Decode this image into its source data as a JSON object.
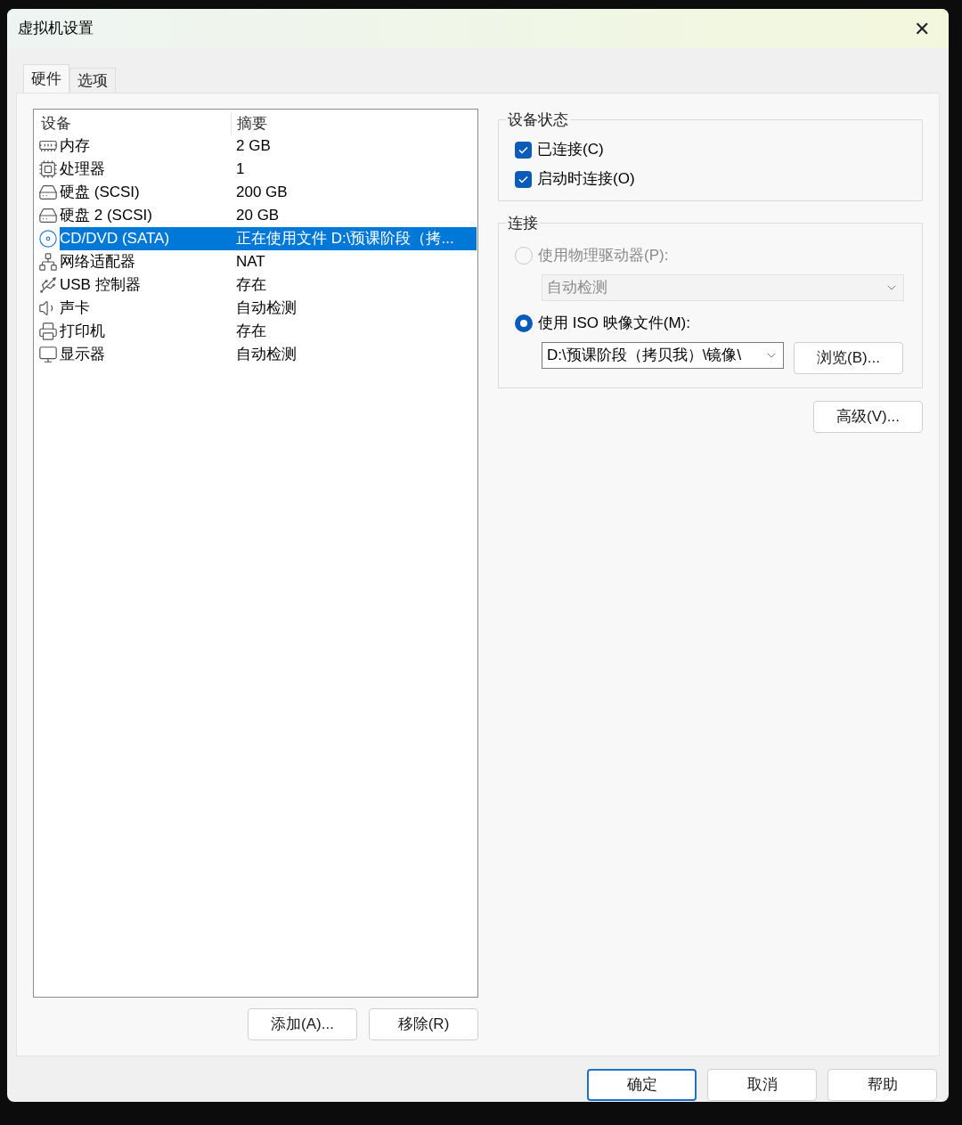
{
  "window": {
    "title": "虚拟机设置",
    "close": "✕"
  },
  "tabs": [
    {
      "label": "硬件",
      "selected": true
    },
    {
      "label": "选项",
      "selected": false
    }
  ],
  "device_list": {
    "columns": [
      "设备",
      "摘要"
    ],
    "rows": [
      {
        "device": "内存",
        "summary": "2 GB",
        "selected": false
      },
      {
        "device": "处理器",
        "summary": "1",
        "selected": false
      },
      {
        "device": "硬盘 (SCSI)",
        "summary": "200 GB",
        "selected": false
      },
      {
        "device": "硬盘 2 (SCSI)",
        "summary": "20 GB",
        "selected": false
      },
      {
        "device": "CD/DVD (SATA)",
        "summary": "正在使用文件 D:\\预课阶段（拷...",
        "selected": true
      },
      {
        "device": "网络适配器",
        "summary": "NAT",
        "selected": false
      },
      {
        "device": "USB 控制器",
        "summary": "存在",
        "selected": false
      },
      {
        "device": "声卡",
        "summary": "自动检测",
        "selected": false
      },
      {
        "device": "打印机",
        "summary": "存在",
        "selected": false
      },
      {
        "device": "显示器",
        "summary": "自动检测",
        "selected": false
      }
    ]
  },
  "list_buttons": [
    "添加(A)...",
    "移除(R)"
  ],
  "device_status": {
    "title": "设备状态",
    "options": [
      {
        "label": "已连接(C)",
        "checked": true
      },
      {
        "label": "启动时连接(O)",
        "checked": true
      }
    ]
  },
  "connection": {
    "title": "连接",
    "options": [
      {
        "label": "使用物理驱动器(P):",
        "selected": false,
        "disabled": true,
        "value": "自动检测"
      },
      {
        "label": "使用 ISO 映像文件(M):",
        "selected": true,
        "disabled": false,
        "value": "D:\\预课阶段（拷贝我）\\镜像\\",
        "button": "浏览(B)..."
      }
    ]
  },
  "advanced_button": "高级(V)...",
  "footer_buttons": [
    {
      "label": "确定",
      "default": true
    },
    {
      "label": "取消",
      "default": false
    },
    {
      "label": "帮助",
      "default": false
    }
  ]
}
